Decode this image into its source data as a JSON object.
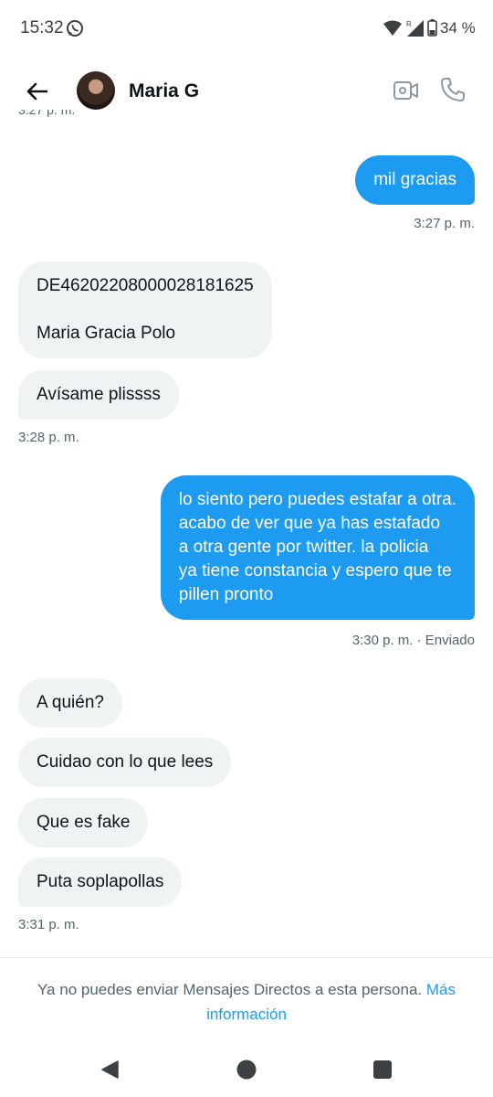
{
  "status_bar": {
    "time": "15:32",
    "battery": "34 %",
    "roaming_mark": "R"
  },
  "header": {
    "contact_name": "Maria G"
  },
  "timestamps": {
    "cut_top": "3:27 p. m.",
    "t1": "3:27 p. m.",
    "t2": "3:28 p. m.",
    "t3": "3:30 p. m. · Enviado",
    "t4": "3:31 p. m."
  },
  "messages": [
    {
      "direction": "out",
      "text": "mil gracias"
    },
    {
      "direction": "in",
      "text": "DE46202208000028181625\n\nMaria Gracia Polo"
    },
    {
      "direction": "in",
      "text": "Avísame plissss"
    },
    {
      "direction": "out",
      "text": "lo siento pero puedes estafar a otra.\nacabo de ver que ya has estafado\na otra gente por twitter. la policia\nya tiene constancia y espero que te\npillen pronto"
    },
    {
      "direction": "in",
      "text": "A quién?"
    },
    {
      "direction": "in",
      "text": "Cuidao con lo que lees"
    },
    {
      "direction": "in",
      "text": "Que es fake"
    },
    {
      "direction": "in",
      "text": "Puta soplapollas"
    }
  ],
  "notice": {
    "text": "Ya no puedes enviar Mensajes Directos a esta persona.",
    "link": "Más información"
  },
  "colors": {
    "accent": "#1d9bf0",
    "incoming_bubble": "#eff3f4",
    "secondary_text": "#536471"
  },
  "icons": [
    "whatsapp-icon",
    "wifi-icon",
    "signal-icon",
    "battery-icon",
    "back-arrow-icon",
    "video-icon",
    "phone-icon",
    "nav-back-icon",
    "nav-home-icon",
    "nav-recents-icon"
  ]
}
